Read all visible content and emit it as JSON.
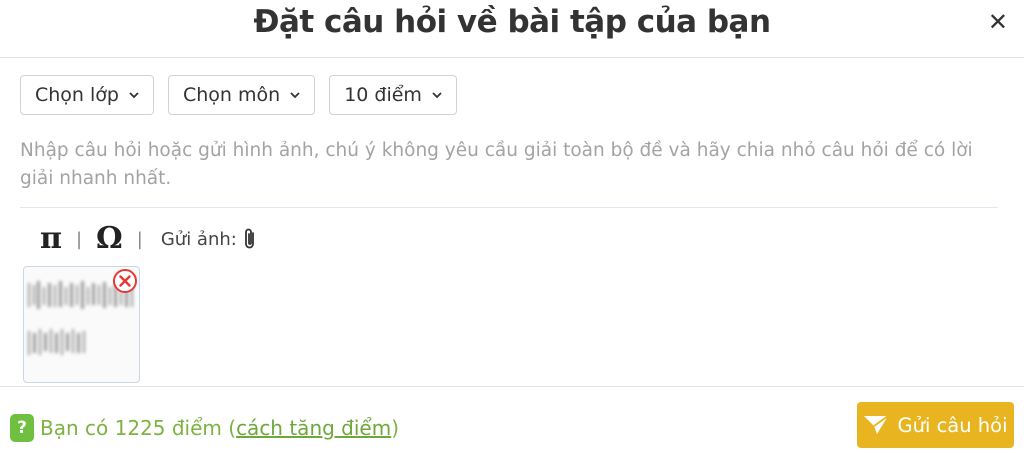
{
  "dialog": {
    "title": "Đặt câu hỏi về bài tập của bạn",
    "close_icon": "close-icon"
  },
  "selects": {
    "grade": "Chọn lớp",
    "subject": "Chọn môn",
    "points": "10 điểm"
  },
  "question": {
    "placeholder": "Nhập câu hỏi hoặc gửi hình ảnh, chú ý không yêu cầu giải toàn bộ đề và hãy chia nhỏ câu hỏi để có lời giải nhanh nhất."
  },
  "toolbar": {
    "math_symbol": "π",
    "special_char": "Ω",
    "separator": "|",
    "upload_label": "Gửi ảnh:",
    "attach_icon": "paperclip-icon"
  },
  "attachment": {
    "remove_icon": "remove-circle-icon"
  },
  "footer": {
    "points_prefix": "Bạn có 1225 điểm (",
    "points_link": "cách tăng điểm",
    "points_suffix": ")",
    "help_badge": "?",
    "send_label": "Gửi câu hỏi"
  },
  "colors": {
    "accent_green": "#6fbf40",
    "send_yellow": "#e8b521",
    "remove_red": "#e53935"
  }
}
